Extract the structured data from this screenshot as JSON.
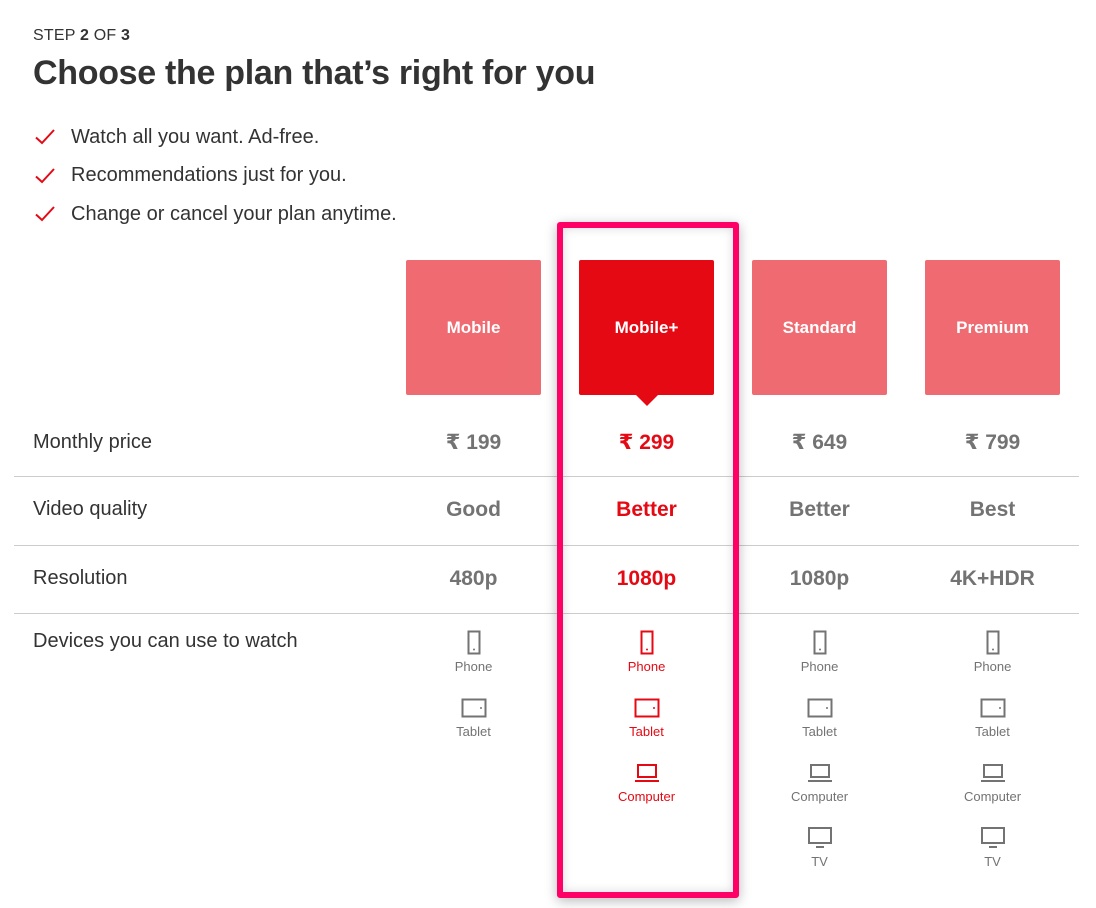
{
  "header": {
    "step_prefix": "STEP",
    "step_current": "2",
    "step_of": "OF",
    "step_total": "3",
    "title": "Choose the plan that’s right for you"
  },
  "features": [
    {
      "icon": "check-icon",
      "text": "Watch all you want. Ad-free."
    },
    {
      "icon": "check-icon",
      "text": "Recommendations just for you."
    },
    {
      "icon": "check-icon",
      "text": "Change or cancel your plan anytime."
    }
  ],
  "colors": {
    "brand_red": "#e50914",
    "highlight_border": "#ff0066",
    "muted_text": "#737373",
    "body_text": "#333333"
  },
  "selected_plan_index": 1,
  "plans": [
    {
      "name": "Mobile",
      "price": "₹ 199",
      "quality": "Good",
      "resolution": "480p",
      "devices": [
        "Phone",
        "Tablet"
      ]
    },
    {
      "name": "Mobile+",
      "price": "₹ 299",
      "quality": "Better",
      "resolution": "1080p",
      "devices": [
        "Phone",
        "Tablet",
        "Computer"
      ]
    },
    {
      "name": "Standard",
      "price": "₹ 649",
      "quality": "Better",
      "resolution": "1080p",
      "devices": [
        "Phone",
        "Tablet",
        "Computer",
        "TV"
      ]
    },
    {
      "name": "Premium",
      "price": "₹ 799",
      "quality": "Best",
      "resolution": "4K+HDR",
      "devices": [
        "Phone",
        "Tablet",
        "Computer",
        "TV"
      ]
    }
  ],
  "rows": {
    "price_label": "Monthly price",
    "quality_label": "Video quality",
    "resolution_label": "Resolution",
    "devices_label": "Devices you can use to watch"
  }
}
